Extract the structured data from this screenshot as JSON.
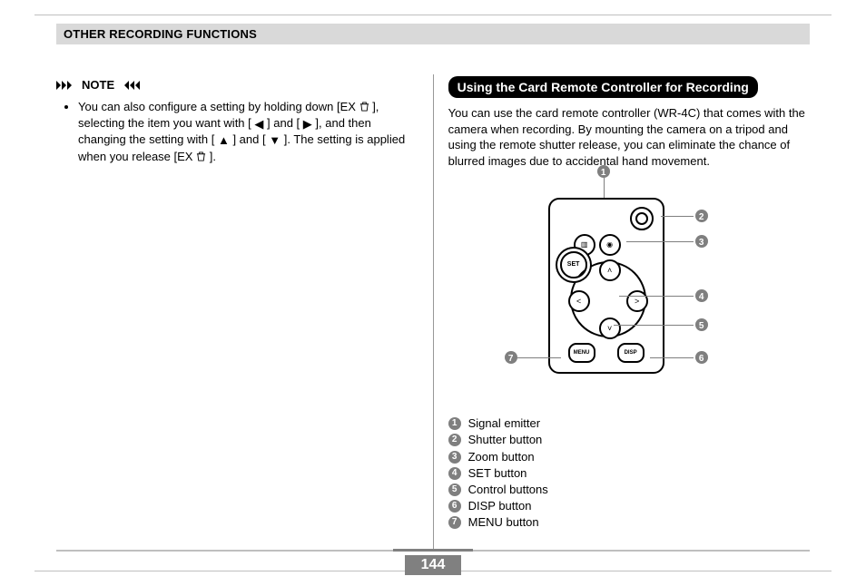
{
  "header": {
    "section_title": "OTHER RECORDING FUNCTIONS"
  },
  "left": {
    "note_label": "NOTE",
    "bullet_prefix": "You can also configure a setting by holding down [EX ",
    "bullet_mid1": "], selecting the item you want with  [",
    "bullet_mid2": "] and [",
    "bullet_mid3": "], and then changing the setting with [",
    "bullet_mid4": "] and [",
    "bullet_mid5": "]. The setting is applied when you release [EX ",
    "bullet_end": "]."
  },
  "right": {
    "heading": "Using the Card Remote Controller for Recording",
    "paragraph": "You can use the card remote controller (WR-4C) that comes with the camera when recording. By mounting the camera on a tripod and using the remote shutter release, you can eliminate the chance of blurred images due to accidental hand movement.",
    "remote": {
      "set_label": "SET",
      "menu_label": "MENU",
      "disp_label": "DISP"
    },
    "callouts": {
      "c1": "1",
      "c2": "2",
      "c3": "3",
      "c4": "4",
      "c5": "5",
      "c6": "6",
      "c7": "7"
    },
    "legend": [
      {
        "n": "1",
        "label": "Signal emitter"
      },
      {
        "n": "2",
        "label": "Shutter button"
      },
      {
        "n": "3",
        "label": "Zoom button"
      },
      {
        "n": "4",
        "label": "SET button"
      },
      {
        "n": "5",
        "label": "Control buttons"
      },
      {
        "n": "6",
        "label": "DISP button"
      },
      {
        "n": "7",
        "label": "MENU button"
      }
    ]
  },
  "page_number": "144"
}
